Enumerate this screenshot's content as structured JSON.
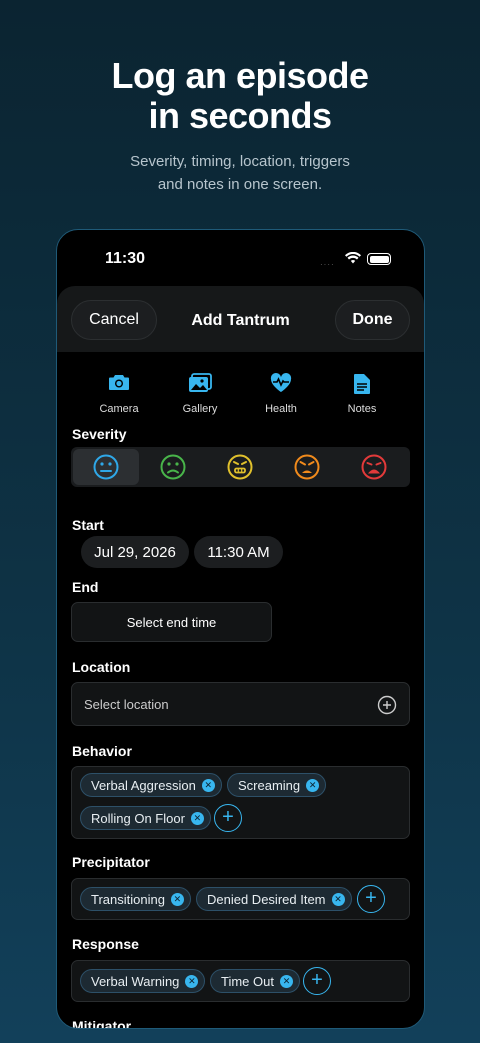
{
  "hero": {
    "title_line1": "Log an episode",
    "title_line2": "in seconds",
    "subtitle_line1": "Severity, timing, location, triggers",
    "subtitle_line2": "and notes in one screen."
  },
  "status_bar": {
    "time": "11:30",
    "signal_dots": "····"
  },
  "sheet": {
    "cancel_label": "Cancel",
    "title": "Add Tantrum",
    "done_label": "Done"
  },
  "attachments": [
    {
      "label": "Camera",
      "icon": "camera-icon"
    },
    {
      "label": "Gallery",
      "icon": "gallery-icon"
    },
    {
      "label": "Health",
      "icon": "heart-pulse-icon"
    },
    {
      "label": "Notes",
      "icon": "notes-icon"
    }
  ],
  "severity": {
    "label": "Severity",
    "selected_index": 0,
    "levels": [
      {
        "icon": "neutral-face-icon",
        "color": "#2fa8e8"
      },
      {
        "icon": "frown-face-icon",
        "color": "#49b54a"
      },
      {
        "icon": "grimace-face-icon",
        "color": "#e0c02c"
      },
      {
        "icon": "angry-face-icon",
        "color": "#f08a1c"
      },
      {
        "icon": "furious-face-icon",
        "color": "#e23a3a"
      }
    ]
  },
  "start": {
    "label": "Start",
    "date": "Jul 29, 2026",
    "time": "11:30 AM"
  },
  "end": {
    "label": "End",
    "placeholder": "Select end time"
  },
  "location": {
    "label": "Location",
    "placeholder": "Select location"
  },
  "behavior": {
    "label": "Behavior",
    "tags": [
      "Verbal Aggression",
      "Screaming",
      "Rolling On Floor"
    ]
  },
  "precipitator": {
    "label": "Precipitator",
    "tags": [
      "Transitioning",
      "Denied Desired Item"
    ]
  },
  "response": {
    "label": "Response",
    "tags": [
      "Verbal Warning",
      "Time Out"
    ]
  },
  "mitigator": {
    "label": "Mitigator"
  },
  "colors": {
    "accent": "#38b6ef",
    "background": "#000000"
  }
}
